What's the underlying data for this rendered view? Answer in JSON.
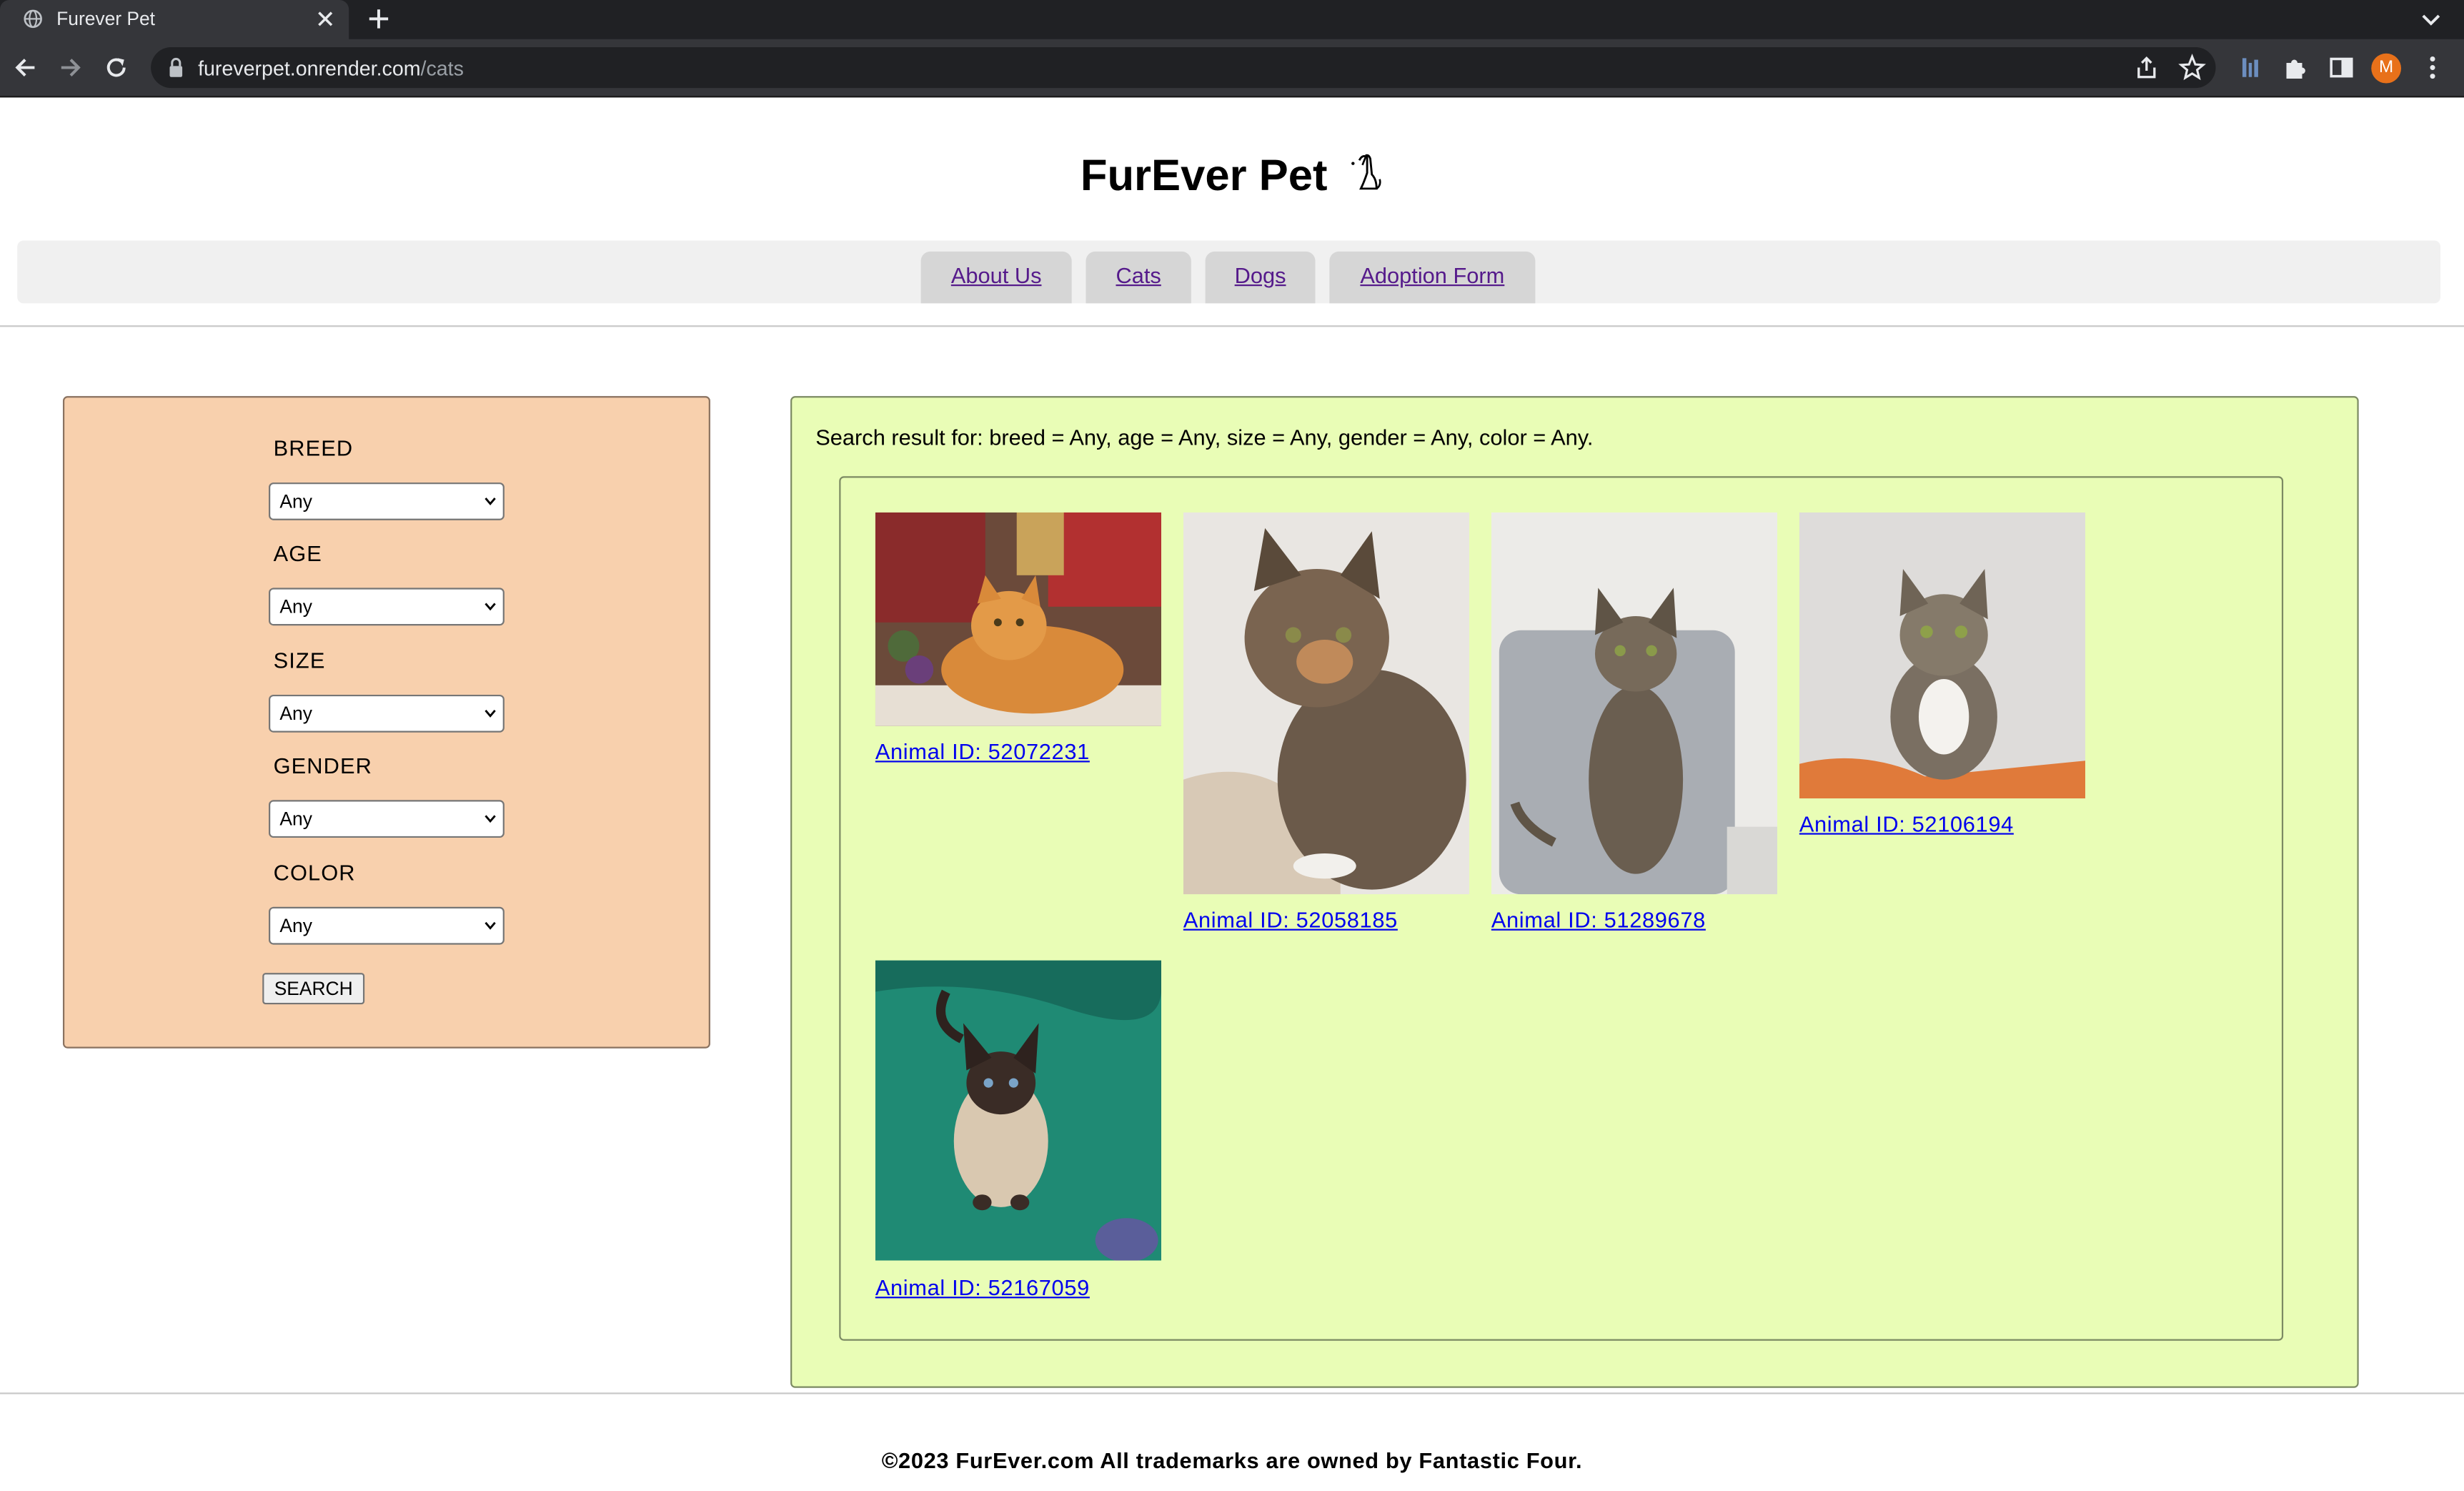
{
  "browser": {
    "tab_title": "Furever Pet",
    "url_host": "fureverpet.onrender.com",
    "url_path": "/cats",
    "profile_initial": "M",
    "icons": [
      "globe-icon",
      "close-icon",
      "plus-icon",
      "chevron-down-icon",
      "back-arrow-icon",
      "forward-arrow-icon",
      "reload-icon",
      "lock-icon",
      "share-icon",
      "bookmark-star-icon",
      "extension-icon",
      "puzzle-icon",
      "side-panel-icon",
      "kebab-menu-icon"
    ]
  },
  "site": {
    "title": "FurEver Pet",
    "logo_icon": "dog-icon"
  },
  "nav": {
    "items": [
      {
        "label": "About Us"
      },
      {
        "label": "Cats"
      },
      {
        "label": "Dogs"
      },
      {
        "label": "Adoption Form"
      }
    ]
  },
  "filters": {
    "breed": {
      "label": "BREED",
      "value": "Any"
    },
    "age": {
      "label": "AGE",
      "value": "Any"
    },
    "size": {
      "label": "SIZE",
      "value": "Any"
    },
    "gender": {
      "label": "GENDER",
      "value": "Any"
    },
    "color": {
      "label": "COLOR",
      "value": "Any"
    },
    "search_label": "SEARCH"
  },
  "results": {
    "summary": "Search result for: breed = Any, age = Any, size = Any, gender = Any, color = Any.",
    "animals": [
      {
        "link": "Animal ID: 52072231",
        "photo": "orange-long-haired-cat-photo"
      },
      {
        "link": "Animal ID: 52058185",
        "photo": "tortoiseshell-long-haired-cat-photo"
      },
      {
        "link": "Animal ID: 51289678",
        "photo": "brown-tabby-cat-sitting-on-chair-photo"
      },
      {
        "link": "Animal ID: 52106194",
        "photo": "tabby-white-cat-photo"
      },
      {
        "link": "Animal ID: 52167059",
        "photo": "siamese-cat-on-green-blanket-photo"
      }
    ]
  },
  "colors": {
    "filter_panel": "#f8d0ad",
    "results_panel": "#e9fdb6",
    "link": "#0000ee",
    "visited_link": "#551a8b"
  },
  "footer": {
    "text": "©2023 FurEver.com All trademarks are owned by Fantastic Four."
  }
}
